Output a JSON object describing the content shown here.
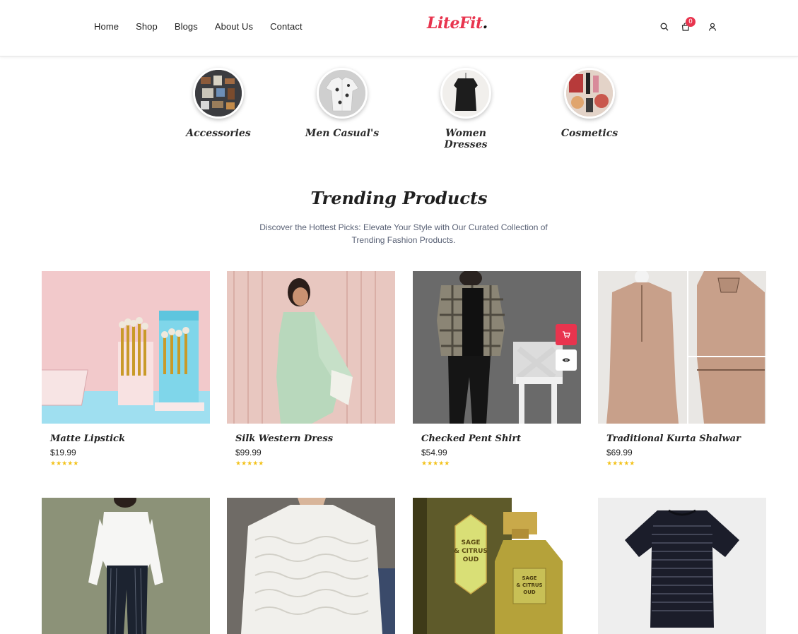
{
  "nav": {
    "links": [
      "Home",
      "Shop",
      "Blogs",
      "About Us",
      "Contact"
    ]
  },
  "logo": {
    "text": "LiteFit",
    "dot": ".",
    "color": "#e8344e"
  },
  "header_icons": {
    "search": "search-icon",
    "cart": "cart-icon",
    "cart_count": "0",
    "user": "user-icon"
  },
  "categories": [
    {
      "label": "Accessories"
    },
    {
      "label": "Men Casual's"
    },
    {
      "label": "Women Dresses"
    },
    {
      "label": "Cosmetics"
    }
  ],
  "trending": {
    "title": "Trending Products",
    "subtitle": "Discover the Hottest Picks: Elevate Your Style with Our Curated Collection of Trending Fashion Products."
  },
  "products": [
    {
      "name": "Matte Lipstick",
      "price": "$19.99",
      "stars": "★★★★★",
      "rating": 5
    },
    {
      "name": "Silk Western Dress",
      "price": "$99.99",
      "stars": "★★★★★",
      "rating": 5
    },
    {
      "name": "Checked Pent Shirt",
      "price": "$54.99",
      "stars": "★★★★★",
      "rating": 5
    },
    {
      "name": "Traditional Kurta Shalwar",
      "price": "$69.99",
      "stars": "★★★★★",
      "rating": 5
    }
  ],
  "product_images": {
    "p5": "SAGE",
    "perfume_label_1": "SAGE",
    "perfume_label_2": "& CITRUS",
    "perfume_label_3": "OUD"
  },
  "colors": {
    "accent": "#e8344e",
    "star": "#f3c21a",
    "subtitle": "#5a6276"
  }
}
